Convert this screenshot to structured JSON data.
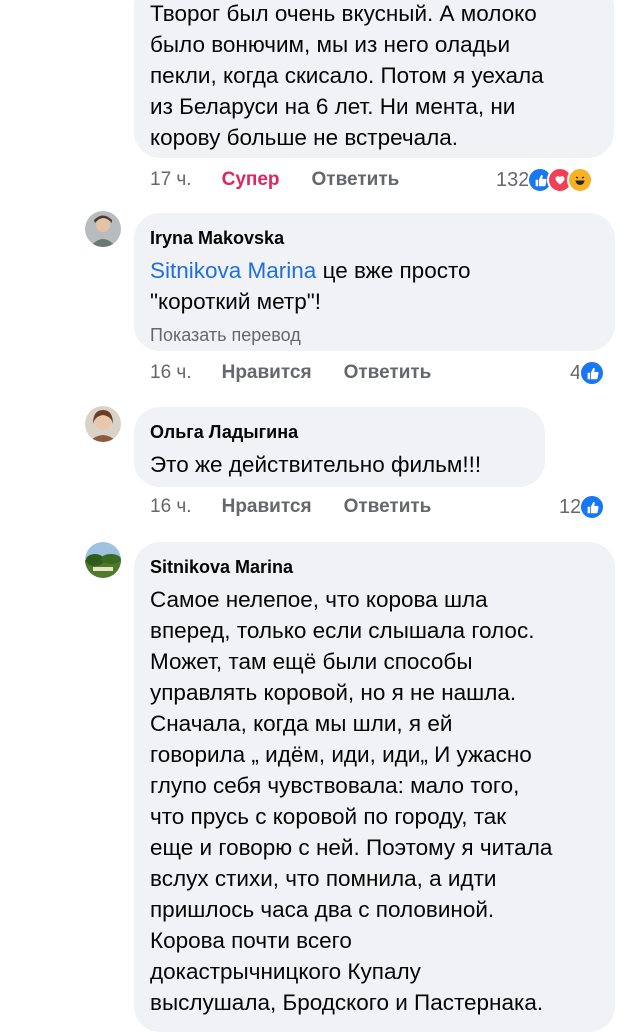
{
  "comments": [
    {
      "text": "Творог был очень вкусный. А молоко\nбыло вонючим, мы из него оладьи\nпекли, когда скисало. Потом я уехала\nиз Беларуси на 6 лет. Ни мента, ни\nкорову больше не встречала.",
      "time": "17 ч.",
      "reaction_label": "Супер",
      "reply": "Ответить",
      "reactions_count": "132",
      "reaction_icons": [
        "like-icon",
        "love-icon",
        "haha-icon"
      ]
    },
    {
      "author": "Iryna Makovska",
      "mention": "Sitnikova Marina",
      "text": " це вже просто\n\"короткий метр\"!",
      "translate": "Показать перевод",
      "time": "16 ч.",
      "like": "Нравится",
      "reply": "Ответить",
      "reactions_count": "4",
      "reaction_icons": [
        "like-icon"
      ]
    },
    {
      "author": "Ольга Ладыгина",
      "text": "Это же действительно фильм!!!",
      "time": "16 ч.",
      "like": "Нравится",
      "reply": "Ответить",
      "reactions_count": "12",
      "reaction_icons": [
        "like-icon"
      ]
    },
    {
      "author": "Sitnikova Marina",
      "text": "Самое нелепое, что корова шла\nвперед, только если слышала голос.\nМожет, там ещё были способы\nуправлять коровой, но я не нашла.\nСначала, когда мы шли, я ей\nговорила „ идём, иди, иди„ И ужасно\nглупо себя чувствовала: мало  того,\nчто прусь с коровой по городу, так\nеще и говорю с ней. Поэтому я читала\nвслух стихи, что помнила, а идти\nпришлось часа два с половиной.\nКорова почти всего\nдокастрычницкого Купалу\nвыслушала, Бродского и Пастернака."
    }
  ],
  "colors": {
    "bubble": "#f0f2f5",
    "meta": "#65676b",
    "super": "#e0245e",
    "mention": "#216fdb",
    "like_blue": "#1877f2",
    "love_red": "#f33e58",
    "haha_yellow": "#f7b125"
  }
}
